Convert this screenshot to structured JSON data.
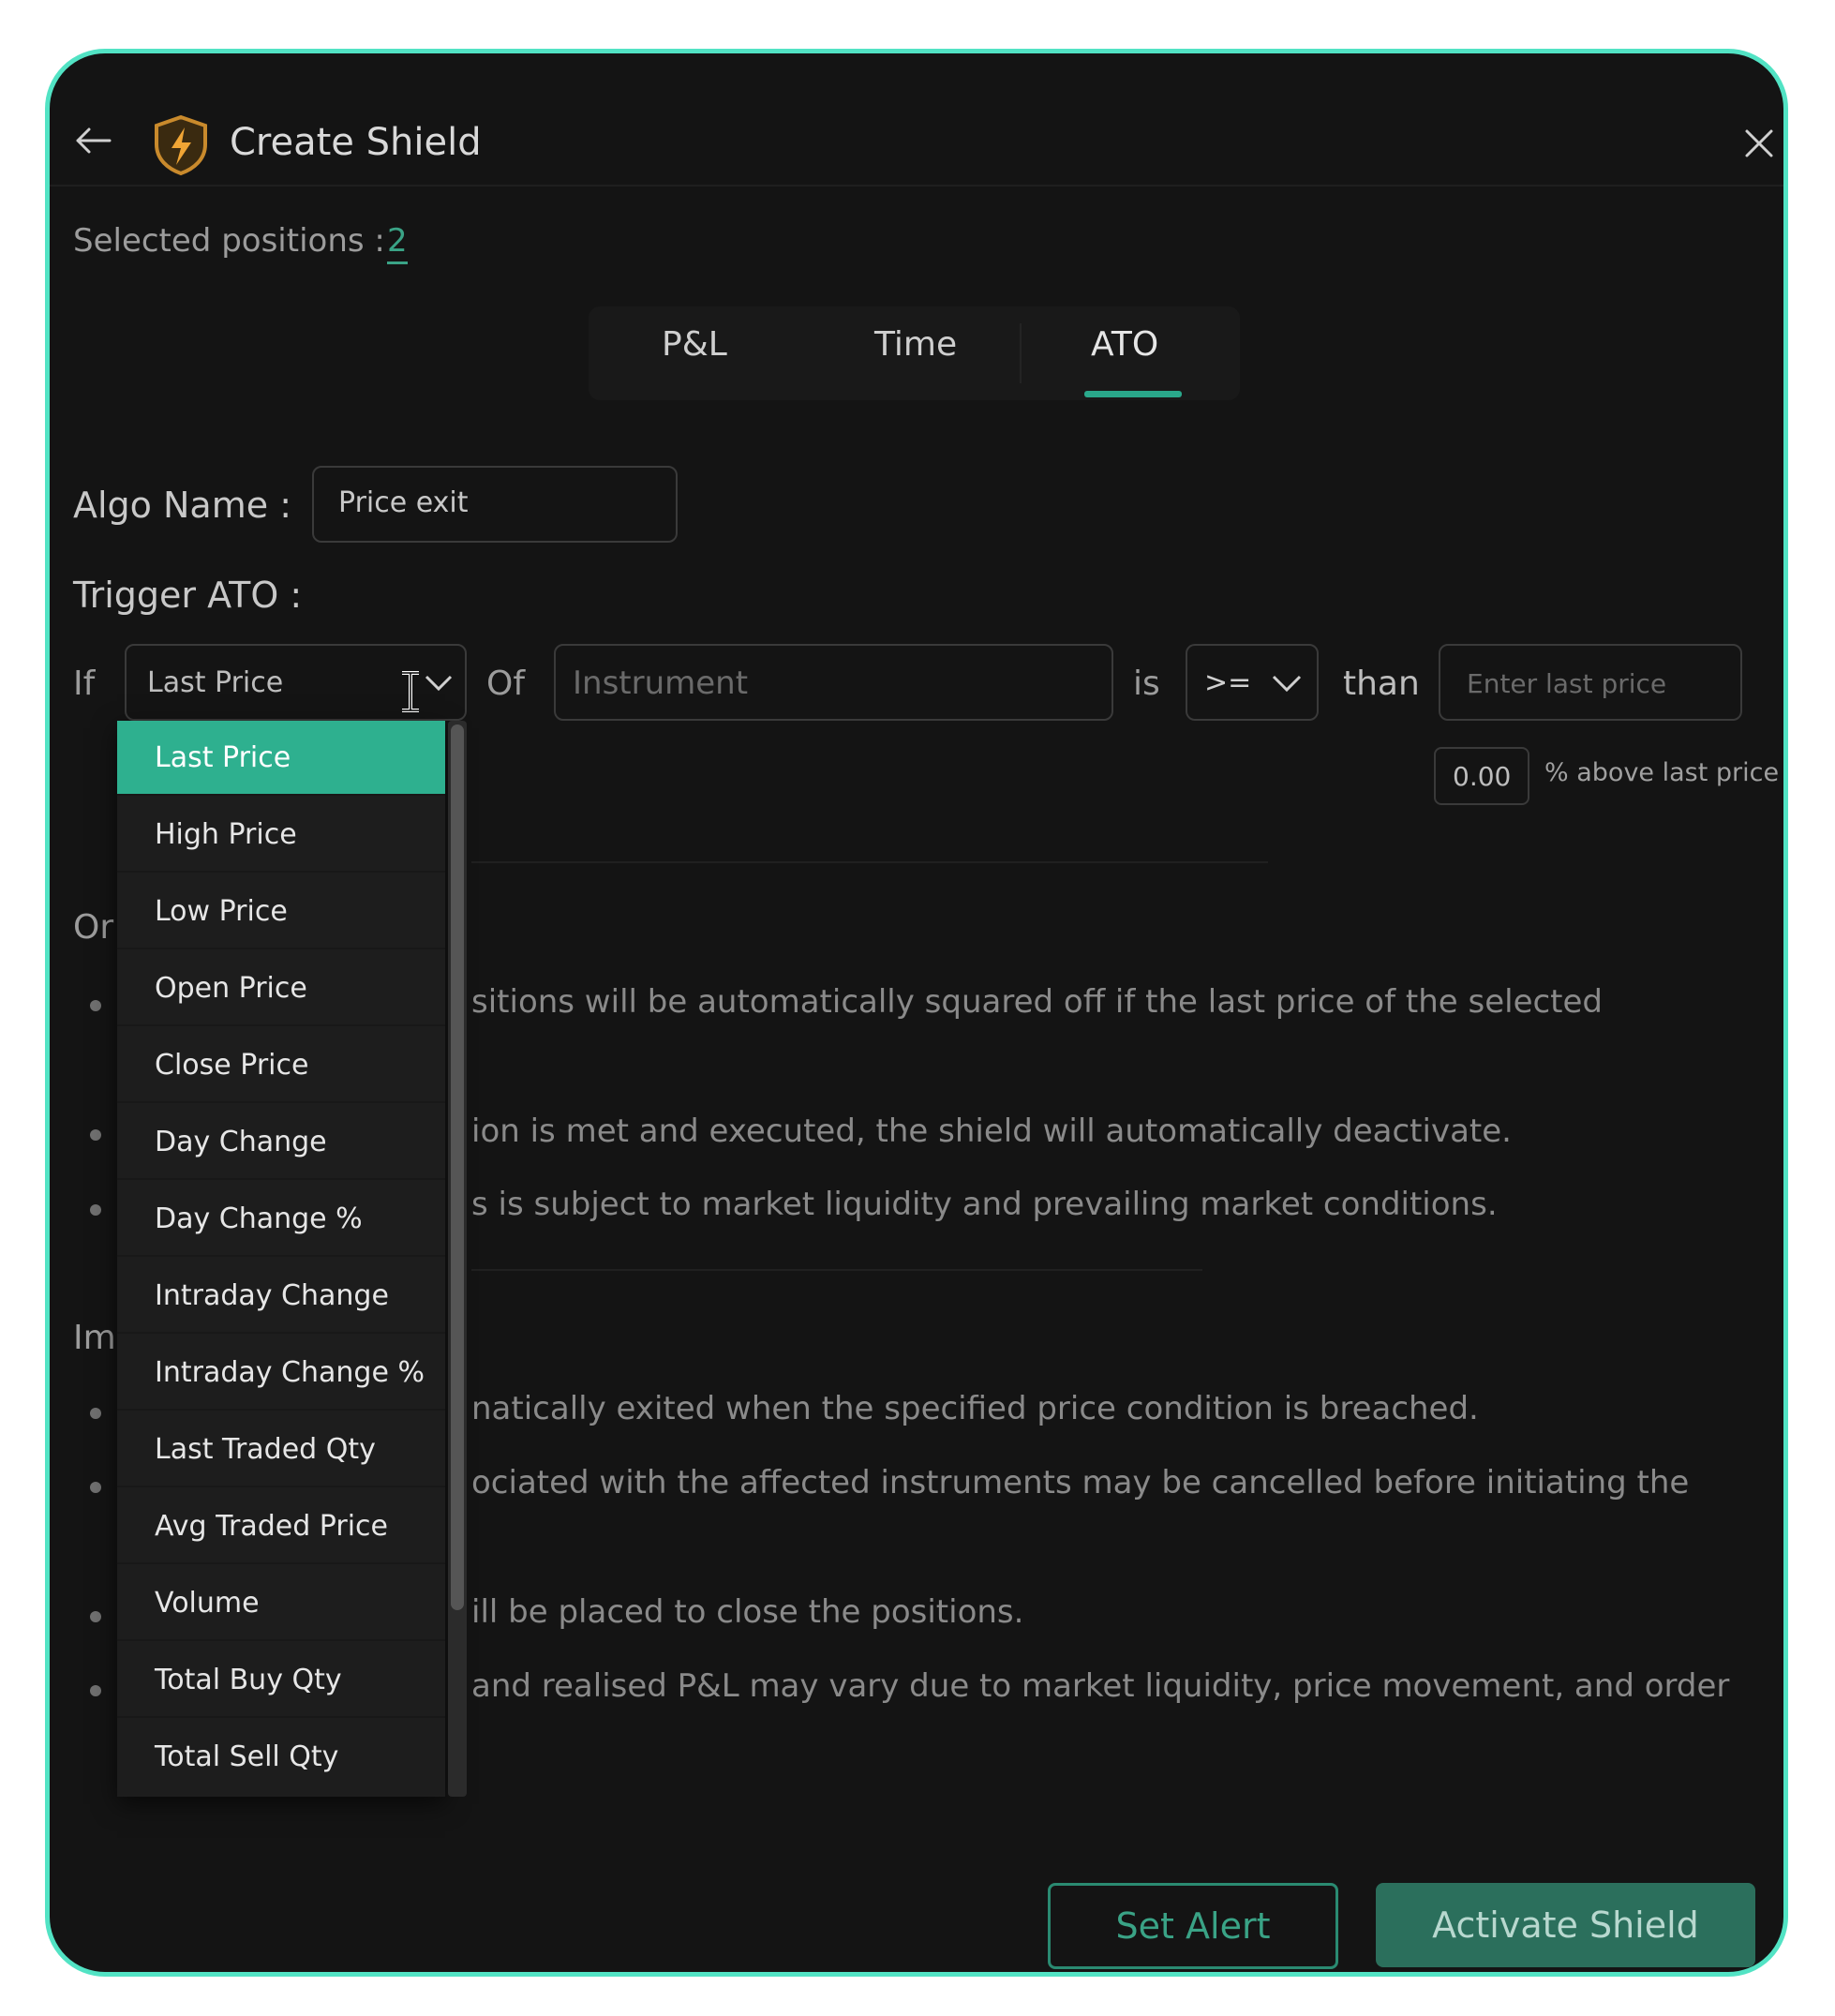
{
  "header": {
    "title": "Create Shield",
    "back_icon": "arrow-left-icon",
    "logo_icon": "shield-lightning-icon",
    "close_icon": "close-icon"
  },
  "selected_positions": {
    "label": "Selected positions :",
    "count": "2"
  },
  "tabs": [
    {
      "label": "P&L",
      "active": false
    },
    {
      "label": "Time",
      "active": false
    },
    {
      "label": "ATO",
      "active": true
    }
  ],
  "algo": {
    "label": "Algo Name :",
    "value": "Price exit"
  },
  "trigger": {
    "label": "Trigger ATO :",
    "if_label": "If",
    "field_value": "Last Price",
    "of_label": "Of",
    "instrument_placeholder": "Instrument",
    "is_label": "is",
    "operator_value": ">=",
    "than_label": "than",
    "price_placeholder": "Enter last price",
    "percent_value": "0.00",
    "percent_label": "% above last price"
  },
  "dropdown": {
    "options": [
      "Last Price",
      "High Price",
      "Low Price",
      "Open Price",
      "Close Price",
      "Day Change",
      "Day Change %",
      "Intraday Change",
      "Intraday Change %",
      "Last Traded Qty",
      "Avg Traded Price",
      "Volume",
      "Total Buy Qty",
      "Total Sell Qty"
    ],
    "selected": "Last Price"
  },
  "section1": {
    "heading_partial": "Or",
    "lines": [
      "sitions will be automatically squared off if the last price of the selected",
      "ion is met and executed, the shield will automatically deactivate.",
      "s is subject to market liquidity and prevailing market conditions."
    ]
  },
  "section2": {
    "heading_partial": "Im",
    "lines": [
      "natically exited when the specified price condition is breached.",
      "ociated with the affected instruments may be cancelled before initiating the",
      "ill be placed to close the positions.",
      "and realised P&L may vary due to market liquidity, price movement, and order"
    ]
  },
  "buttons": {
    "set_alert": "Set Alert",
    "activate": "Activate Shield"
  },
  "colors": {
    "accent": "#52e3c4",
    "brand_green": "#2eb08f",
    "panel_bg": "#141414"
  }
}
